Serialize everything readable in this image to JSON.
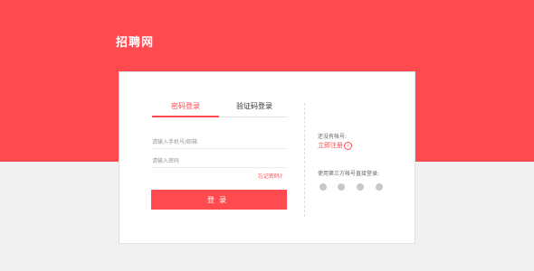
{
  "header": {
    "brand": "招聘网"
  },
  "login": {
    "tabs": [
      {
        "label": "密码登录",
        "active": true
      },
      {
        "label": "验证码登录",
        "active": false
      }
    ],
    "account_placeholder": "请输入手机号/邮箱",
    "password_placeholder": "请输入密码",
    "forgot_label": "忘记密码?",
    "submit_label": "登录"
  },
  "side": {
    "no_account_text": "还没有帐号:",
    "register_label": "立即注册",
    "third_party_label": "使用第三方帐号直接登录:",
    "social_icons": [
      "weibo-icon",
      "wechat-icon",
      "qq-icon",
      "douban-icon"
    ]
  },
  "colors": {
    "accent": "#ff4a4f",
    "background": "#f0f0f0"
  }
}
